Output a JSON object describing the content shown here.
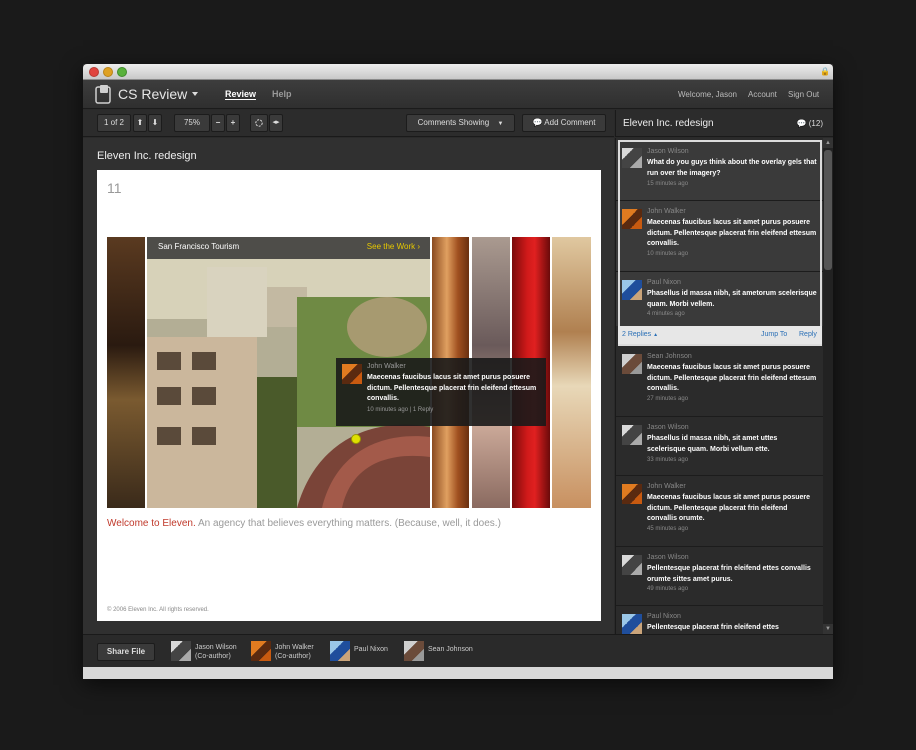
{
  "app": {
    "name": "CS Review",
    "nav": {
      "review": "Review",
      "help": "Help"
    },
    "user": {
      "welcome": "Welcome, Jason",
      "account": "Account",
      "signout": "Sign Out"
    }
  },
  "toolbar": {
    "page_indicator": "1 of 2",
    "zoom": "75%",
    "comments_showing": "Comments Showing",
    "add_comment": "Add Comment"
  },
  "panel": {
    "title": "Eleven Inc. redesign",
    "count": "(12)"
  },
  "document": {
    "title": "Eleven Inc. redesign",
    "page_number": "11",
    "hero_label": "San Francisco Tourism",
    "hero_link": "See the Work ›",
    "popup": {
      "name": "John Walker",
      "text": "Maecenas faucibus lacus sit amet purus posuere dictum. Pellentesque placerat frin eleifend ettesum convallis.",
      "meta": "10 minutes ago  |  1 Reply"
    },
    "welcome_red": "Welcome to Eleven.",
    "welcome_gray": " An agency that believes everything matters. (Because, well, it does.)",
    "copyright": "© 2006 Eleven Inc. All rights reserved."
  },
  "comments": [
    {
      "name": "Jason Wilson",
      "text": "What do you guys think about the overlay gels that run over the imagery?",
      "time": "15 minutes ago"
    },
    {
      "name": "John Walker",
      "text": "Maecenas faucibus lacus sit amet purus posuere dictum. Pellentesque placerat frin eleifend ettesum convallis.",
      "time": "10 minutes ago"
    },
    {
      "name": "Paul Nixon",
      "text": "Phasellus id massa nibh, sit ametorum scelerisque quam. Morbi vellem.",
      "time": "4 minutes ago"
    },
    {
      "name": "Sean Johnson",
      "text": "Maecenas faucibus lacus sit amet purus posuere dictum. Pellentesque placerat frin eleifend ettesum convallis.",
      "time": "27 minutes ago"
    },
    {
      "name": "Jason Wilson",
      "text": "Phasellus id massa nibh, sit amet uttes scelerisque quam. Morbi vellum ette.",
      "time": "33 minutes ago"
    },
    {
      "name": "John Walker",
      "text": "Maecenas faucibus lacus sit amet purus posuere dictum. Pellentesque placerat frin eleifend convallis orumte.",
      "time": "45 minutes ago"
    },
    {
      "name": "Jason Wilson",
      "text": "Pellentesque placerat frin eleifend ettes convallis orumte sittes amet purus.",
      "time": "49 minutes ago"
    },
    {
      "name": "Paul Nixon",
      "text": "Pellentesque placerat frin eleifend ettes",
      "time": ""
    }
  ],
  "thread_actions": {
    "replies": "2 Replies",
    "jump": "Jump To",
    "reply": "Reply"
  },
  "footer": {
    "share": "Share File",
    "collaborators": [
      {
        "name": "Jason Wilson",
        "role": "(Co-author)"
      },
      {
        "name": "John Walker",
        "role": "(Co-author)"
      },
      {
        "name": "Paul Nixon",
        "role": ""
      },
      {
        "name": "Sean Johnson",
        "role": ""
      }
    ]
  }
}
